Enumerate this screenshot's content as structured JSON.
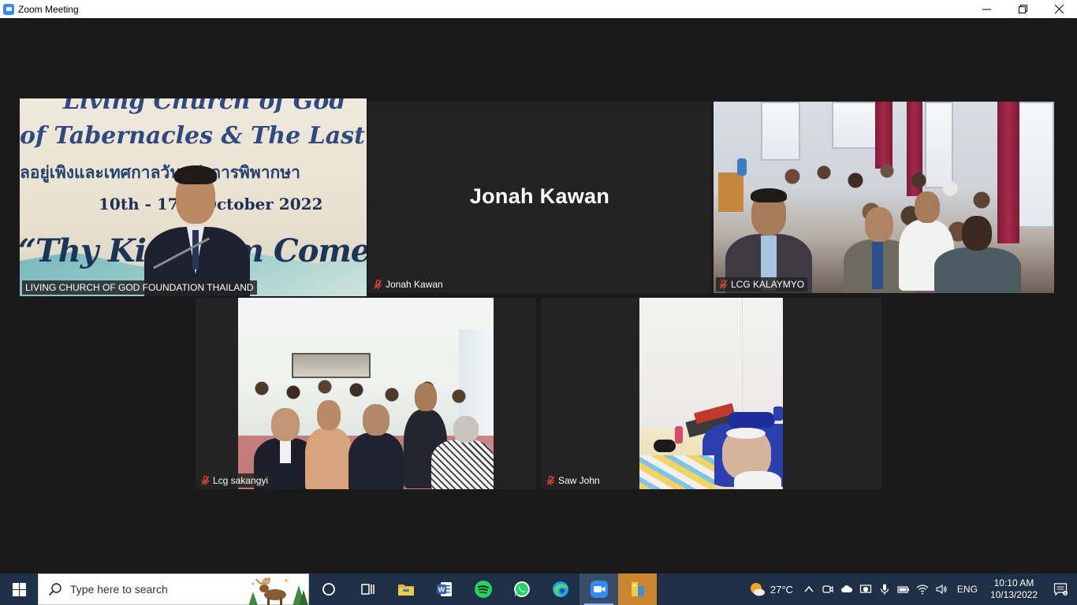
{
  "window": {
    "title": "Zoom Meeting",
    "icon": "zoom-icon"
  },
  "tiles": [
    {
      "name": "LIVING CHURCH OF GOD FOUNDATION THAILAND",
      "muted": false,
      "active_speaker": true,
      "banner": {
        "line1": "Living Church of God",
        "line2": "of Tabernacles & The Last G",
        "line3": "ลอยู่เพิงและเทศกาลวันแห่งการพิพากษา",
        "dates": "10th - 17th October 2022",
        "slogan": "“Thy Kingdom Come”"
      }
    },
    {
      "name": "Jonah Kawan",
      "muted": true,
      "video": false,
      "display_name": "Jonah Kawan"
    },
    {
      "name": "LCG KALAYMYO",
      "muted": true
    },
    {
      "name": "Lcg sakangyi",
      "muted": true
    },
    {
      "name": "Saw John",
      "muted": true
    }
  ],
  "taskbar": {
    "search_placeholder": "Type here to search",
    "apps": [
      "task-view-icon",
      "file-explorer-icon",
      "word-icon",
      "spotify-icon",
      "whatsapp-icon",
      "edge-icon",
      "zoom-icon",
      "files-icon"
    ],
    "weather_temp": "27°C",
    "language": "ENG",
    "time": "10:10 AM",
    "date": "10/13/2022"
  },
  "colors": {
    "active_speaker_border": "#c8e15a",
    "taskbar": "#1f2f46",
    "zoom_blue": "#2d8cff"
  }
}
